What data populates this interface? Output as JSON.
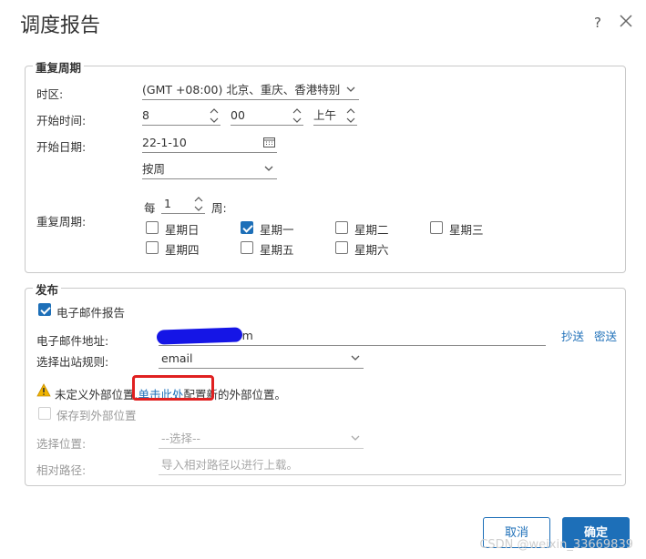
{
  "dialog": {
    "title": "调度报告",
    "help_label": "?"
  },
  "repeat_section": {
    "legend": "重复周期",
    "timezone_label": "时区:",
    "timezone_value": "(GMT +08:00) 北京、重庆、香港特别",
    "start_time_label": "开始时间:",
    "hour": "8",
    "minute": "00",
    "ampm": "上午",
    "start_date_label": "开始日期:",
    "start_date": "22-1-10",
    "frequency": "按周",
    "repeat_label": "重复周期:",
    "every_prefix": "每",
    "every_value": "1",
    "every_unit": "周:",
    "days": [
      {
        "label": "星期日",
        "checked": false
      },
      {
        "label": "星期一",
        "checked": true
      },
      {
        "label": "星期二",
        "checked": false
      },
      {
        "label": "星期三",
        "checked": false
      },
      {
        "label": "星期四",
        "checked": false
      },
      {
        "label": "星期五",
        "checked": false
      },
      {
        "label": "星期六",
        "checked": false
      }
    ]
  },
  "publish_section": {
    "legend": "发布",
    "email_report_label": "电子邮件报告",
    "email_address_label": "电子邮件地址:",
    "email_address_value": "om",
    "cc_label": "抄送",
    "bcc_label": "密送",
    "outbound_rule_label": "选择出站规则:",
    "outbound_rule_value": "email",
    "warning_prefix": "未定义外部位置,",
    "warning_link": "单击此处",
    "warning_suffix": "配置新的外部位置。",
    "save_external_label": "保存到外部位置",
    "select_location_label": "选择位置:",
    "select_location_placeholder": "--选择--",
    "relative_path_label": "相对路径:",
    "relative_path_placeholder": "导入相对路径以进行上载。"
  },
  "footer": {
    "cancel_label": "取消",
    "ok_label": "确定"
  },
  "watermark": "CSDN @weixin_33669839",
  "colors": {
    "accent": "#1d6fb8",
    "redaction": "#1515e6",
    "highlight": "#e02020",
    "warning": "#f0b400"
  }
}
